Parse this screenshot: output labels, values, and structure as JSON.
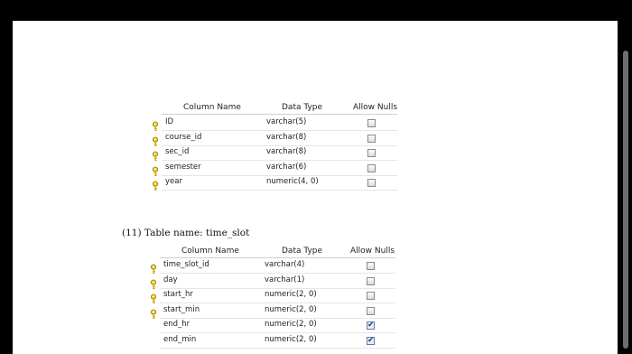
{
  "tables": [
    {
      "columns_header": {
        "name": "Column Name",
        "type": "Data Type",
        "nulls": "Allow Nulls"
      },
      "rows": [
        {
          "name": "ID",
          "type": "varchar(5)",
          "key": true,
          "nulls": false
        },
        {
          "name": "course_id",
          "type": "varchar(8)",
          "key": true,
          "nulls": false
        },
        {
          "name": "sec_id",
          "type": "varchar(8)",
          "key": true,
          "nulls": false
        },
        {
          "name": "semester",
          "type": "varchar(6)",
          "key": true,
          "nulls": false
        },
        {
          "name": "year",
          "type": "numeric(4, 0)",
          "key": true,
          "nulls": false
        }
      ]
    },
    {
      "caption": "(11) Table name: time_slot",
      "columns_header": {
        "name": "Column Name",
        "type": "Data Type",
        "nulls": "Allow Nulls"
      },
      "rows": [
        {
          "name": "time_slot_id",
          "type": "varchar(4)",
          "key": true,
          "nulls": false
        },
        {
          "name": "day",
          "type": "varchar(1)",
          "key": true,
          "nulls": false
        },
        {
          "name": "start_hr",
          "type": "numeric(2, 0)",
          "key": true,
          "nulls": false
        },
        {
          "name": "start_min",
          "type": "numeric(2, 0)",
          "key": true,
          "nulls": false
        },
        {
          "name": "end_hr",
          "type": "numeric(2, 0)",
          "key": false,
          "nulls": true
        },
        {
          "name": "end_min",
          "type": "numeric(2, 0)",
          "key": false,
          "nulls": true
        }
      ]
    }
  ],
  "icons": {
    "primary_key": "key-icon",
    "checkbox": "checkbox-icon"
  },
  "colors": {
    "key": "#d8b400",
    "background": "#ffffff",
    "frame": "#000000"
  }
}
